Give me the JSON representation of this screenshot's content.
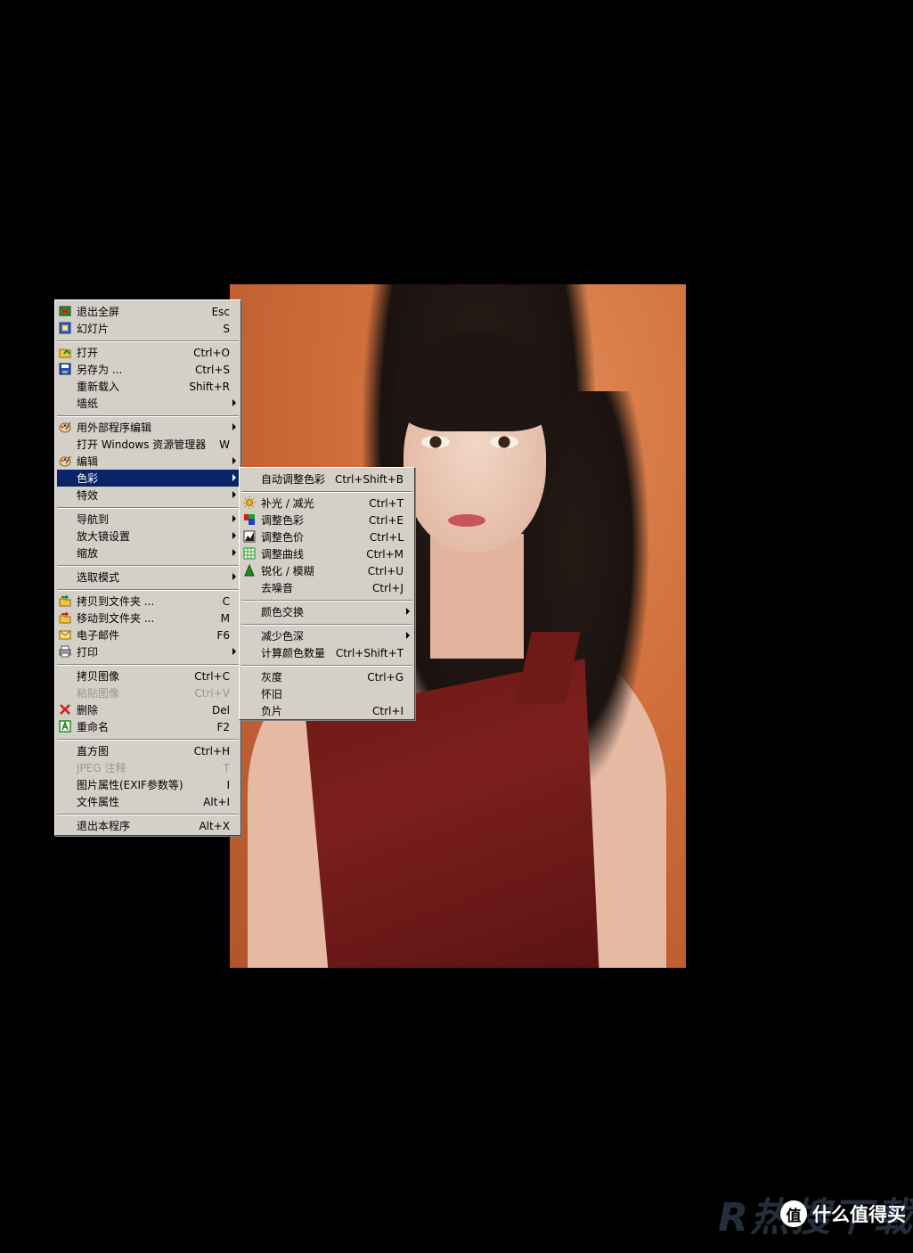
{
  "main_menu": {
    "items": [
      {
        "label": "退出全屏",
        "shortcut": "Esc",
        "icon": "exit-fullscreen-icon"
      },
      {
        "label": "幻灯片",
        "shortcut": "S",
        "icon": "slideshow-icon"
      },
      {
        "label": "打开",
        "shortcut": "Ctrl+O",
        "icon": "open-folder-icon"
      },
      {
        "label": "另存为 ...",
        "shortcut": "Ctrl+S",
        "icon": "floppy-disk-icon"
      },
      {
        "label": "重新载入",
        "shortcut": "Shift+R"
      },
      {
        "label": "墙纸",
        "shortcut": ""
      },
      {
        "label": "用外部程序编辑",
        "shortcut": "",
        "icon": "palette-icon"
      },
      {
        "label": "打开 Windows 资源管理器",
        "shortcut": "W"
      },
      {
        "label": "编辑",
        "shortcut": "",
        "icon": "palette-icon"
      },
      {
        "label": "色彩",
        "shortcut": ""
      },
      {
        "label": "特效",
        "shortcut": ""
      },
      {
        "label": "导航到",
        "shortcut": ""
      },
      {
        "label": "放大镜设置",
        "shortcut": ""
      },
      {
        "label": "缩放",
        "shortcut": ""
      },
      {
        "label": "选取模式",
        "shortcut": ""
      },
      {
        "label": "拷贝到文件夹 ...",
        "shortcut": "C",
        "icon": "copy-to-folder-icon"
      },
      {
        "label": "移动到文件夹 ...",
        "shortcut": "M",
        "icon": "move-to-folder-icon"
      },
      {
        "label": "电子邮件",
        "shortcut": "F6",
        "icon": "email-icon"
      },
      {
        "label": "打印",
        "shortcut": "",
        "icon": "printer-icon"
      },
      {
        "label": "拷贝图像",
        "shortcut": "Ctrl+C"
      },
      {
        "label": "粘贴图像",
        "shortcut": "Ctrl+V"
      },
      {
        "label": "删除",
        "shortcut": "Del",
        "icon": "delete-x-icon"
      },
      {
        "label": "重命名",
        "shortcut": "F2",
        "icon": "rename-icon"
      },
      {
        "label": "直方图",
        "shortcut": "Ctrl+H"
      },
      {
        "label": "JPEG 注释",
        "shortcut": "T"
      },
      {
        "label": "图片属性(EXIF参数等)",
        "shortcut": "I"
      },
      {
        "label": "文件属性",
        "shortcut": "Alt+I"
      },
      {
        "label": "退出本程序",
        "shortcut": "Alt+X"
      }
    ]
  },
  "sub_menu": {
    "items": [
      {
        "label": "自动调整色彩",
        "shortcut": "Ctrl+Shift+B"
      },
      {
        "label": "补光 / 减光",
        "shortcut": "Ctrl+T",
        "icon": "sun-icon"
      },
      {
        "label": "调整色彩",
        "shortcut": "Ctrl+E",
        "icon": "color-squares-icon"
      },
      {
        "label": "调整色价",
        "shortcut": "Ctrl+L",
        "icon": "levels-icon"
      },
      {
        "label": "调整曲线",
        "shortcut": "Ctrl+M",
        "icon": "curves-icon"
      },
      {
        "label": "锐化 / 模糊",
        "shortcut": "Ctrl+U",
        "icon": "sharpen-icon"
      },
      {
        "label": "去噪音",
        "shortcut": "Ctrl+J"
      },
      {
        "label": "颜色交换",
        "shortcut": ""
      },
      {
        "label": "减少色深",
        "shortcut": ""
      },
      {
        "label": "计算颜色数量",
        "shortcut": "Ctrl+Shift+T"
      },
      {
        "label": "灰度",
        "shortcut": "Ctrl+G"
      },
      {
        "label": "怀旧",
        "shortcut": ""
      },
      {
        "label": "负片",
        "shortcut": "Ctrl+I"
      }
    ]
  },
  "watermark": {
    "logo_text": "R热搜下载",
    "badge": "值",
    "site": "什么值得买"
  }
}
